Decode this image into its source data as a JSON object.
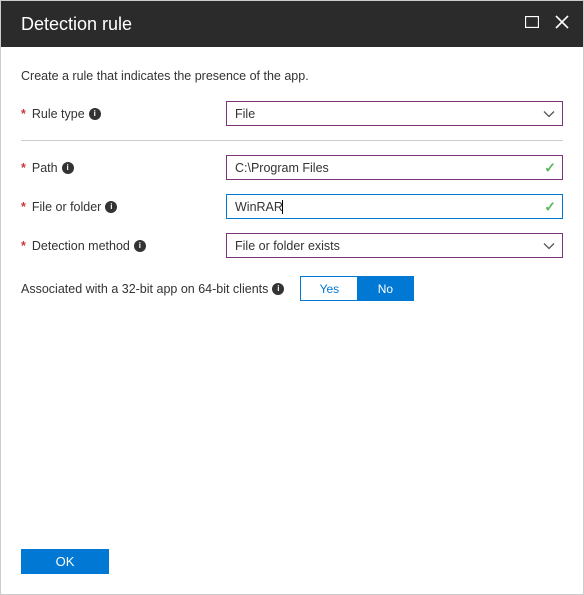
{
  "header": {
    "title": "Detection rule"
  },
  "description": "Create a rule that indicates the presence of the app.",
  "fields": {
    "ruleType": {
      "label": "Rule type",
      "value": "File"
    },
    "path": {
      "label": "Path",
      "value": "C:\\Program Files"
    },
    "fileOrFolder": {
      "label": "File or folder",
      "value": "WinRAR"
    },
    "detectionMethod": {
      "label": "Detection method",
      "value": "File or folder exists"
    }
  },
  "toggle": {
    "label": "Associated with a 32-bit app on 64-bit clients",
    "yes": "Yes",
    "no": "No"
  },
  "footer": {
    "ok": "OK"
  }
}
